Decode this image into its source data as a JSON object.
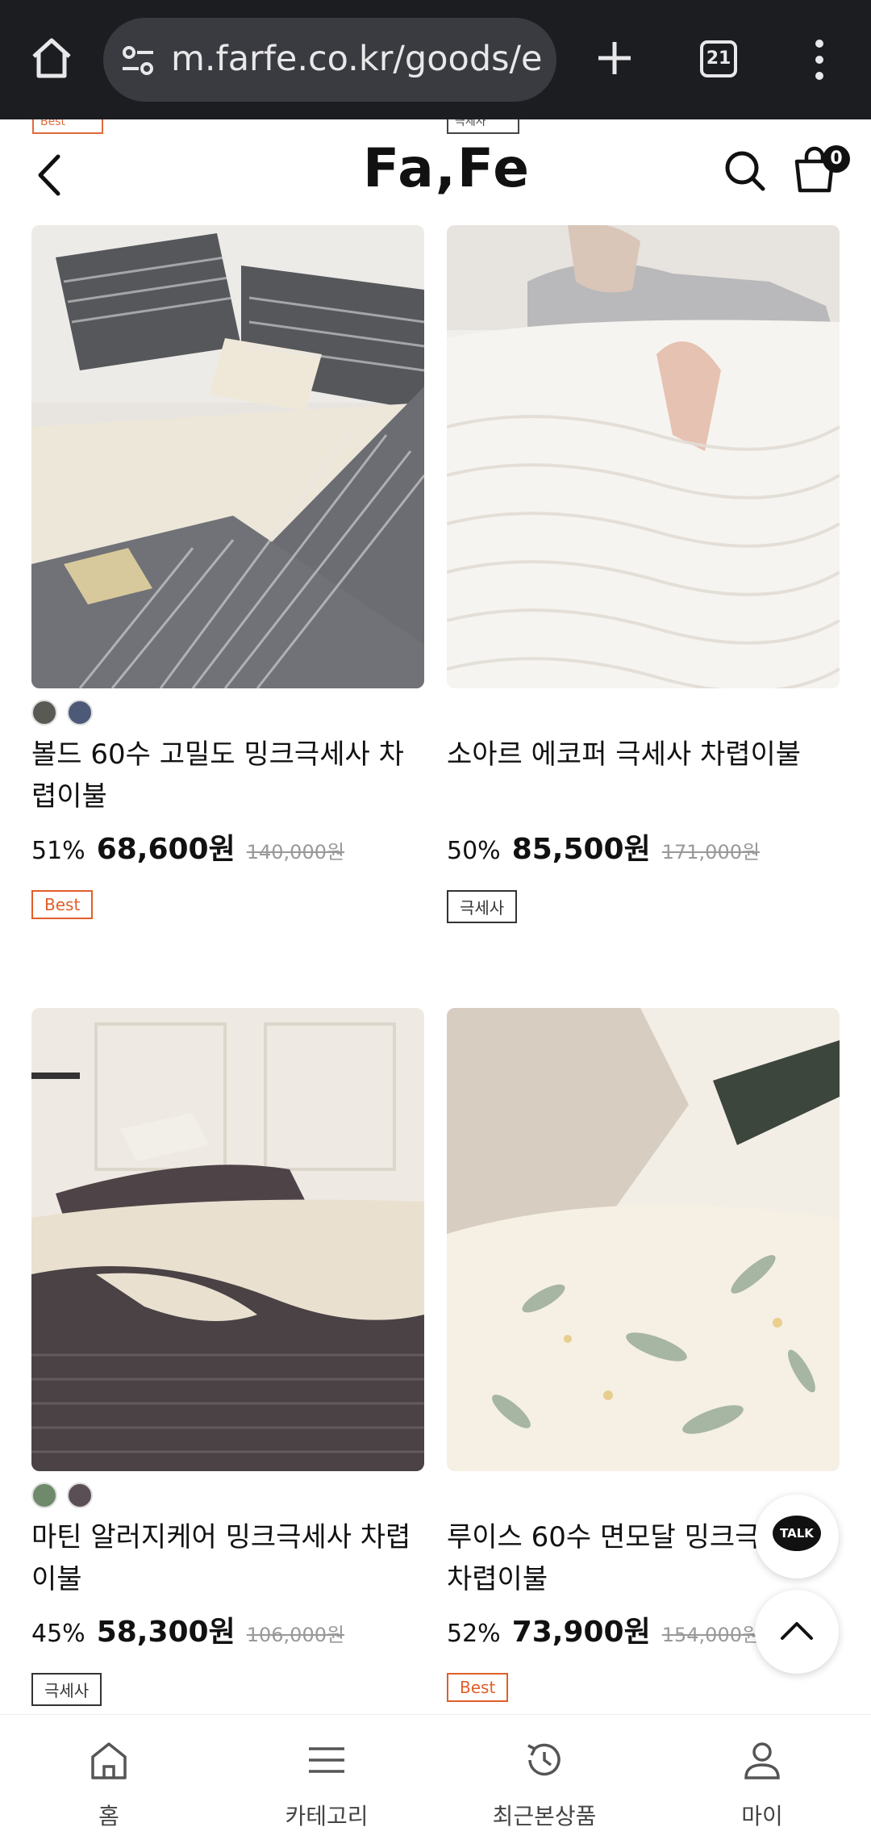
{
  "browser": {
    "url": "m.farfe.co.kr/goods/e",
    "tab_count": "21"
  },
  "header": {
    "logo": "Fa,Fe",
    "cart_count": "0",
    "peek_badge_left": "Best",
    "peek_badge_right": "극세사"
  },
  "products": [
    {
      "title": "볼드 60수 고밀도 밍크극세사 차렵이불",
      "discount": "51%",
      "price": "68,600원",
      "original_price": "140,000원",
      "badge": "Best",
      "swatches": [
        "#5a5a55",
        "#4c5a78"
      ]
    },
    {
      "title": "소아르 에코퍼 극세사 차렵이불",
      "discount": "50%",
      "price": "85,500원",
      "original_price": "171,000원",
      "badge": "극세사",
      "swatches": []
    },
    {
      "title": "마틴 알러지케어 밍크극세사 차렵이불",
      "discount": "45%",
      "price": "58,300원",
      "original_price": "106,000원",
      "badge": "극세사",
      "swatches": [
        "#6e8a6a",
        "#5a4f55"
      ]
    },
    {
      "title": "루이스 60수 면모달 밍크극세사 차렵이불",
      "discount": "52%",
      "price": "73,900원",
      "original_price": "154,000원",
      "badge": "Best",
      "swatches": []
    }
  ],
  "floating": {
    "talk_label": "TALK"
  },
  "bottom_nav": [
    {
      "label": "홈",
      "icon": "home-icon"
    },
    {
      "label": "카테고리",
      "icon": "menu-icon"
    },
    {
      "label": "최근본상품",
      "icon": "history-icon"
    },
    {
      "label": "마이",
      "icon": "user-icon"
    }
  ]
}
